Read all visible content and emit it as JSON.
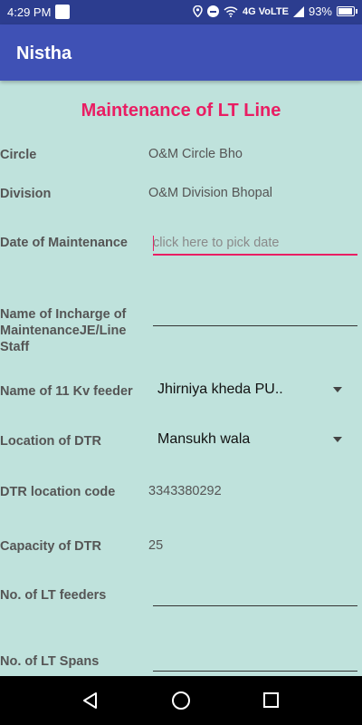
{
  "status_bar": {
    "time": "4:29 PM",
    "network": "4G VoLTE",
    "battery": "93%",
    "battery_level": 0.93
  },
  "app_bar": {
    "title": "Nistha"
  },
  "form": {
    "title": "Maintenance of LT Line",
    "circle_label": "Circle",
    "circle_value": "O&M Circle Bho",
    "division_label": "Division",
    "division_value": "O&M Division Bhopal",
    "date_label": "Date of Maintenance",
    "date_placeholder": "click here to pick date",
    "incharge_label": "Name of Incharge of MaintenanceJE/Line Staff",
    "incharge_value": "",
    "feeder_label": "Name of 11 Kv feeder",
    "feeder_value": "Jhirniya  kheda PU..",
    "dtr_location_label": "Location of DTR",
    "dtr_location_value": "Mansukh wala",
    "dtr_code_label": "DTR location code",
    "dtr_code_value": "3343380292",
    "capacity_label": "Capacity of DTR",
    "capacity_value": "25",
    "lt_feeders_label": "No. of LT feeders",
    "lt_feeders_value": "",
    "lt_spans_label": "No. of LT Spans",
    "lt_spans_value": ""
  },
  "icons": {
    "status": [
      "notification-icon",
      "location-icon",
      "dnd-icon",
      "wifi-icon",
      "signal-icon",
      "battery-icon"
    ],
    "nav": [
      "back-icon",
      "home-icon",
      "recents-icon"
    ]
  },
  "colors": {
    "status_bar": "#2c3d8f",
    "app_bar": "#3f51b5",
    "background": "#bfe2dc",
    "accent": "#e91e63"
  }
}
